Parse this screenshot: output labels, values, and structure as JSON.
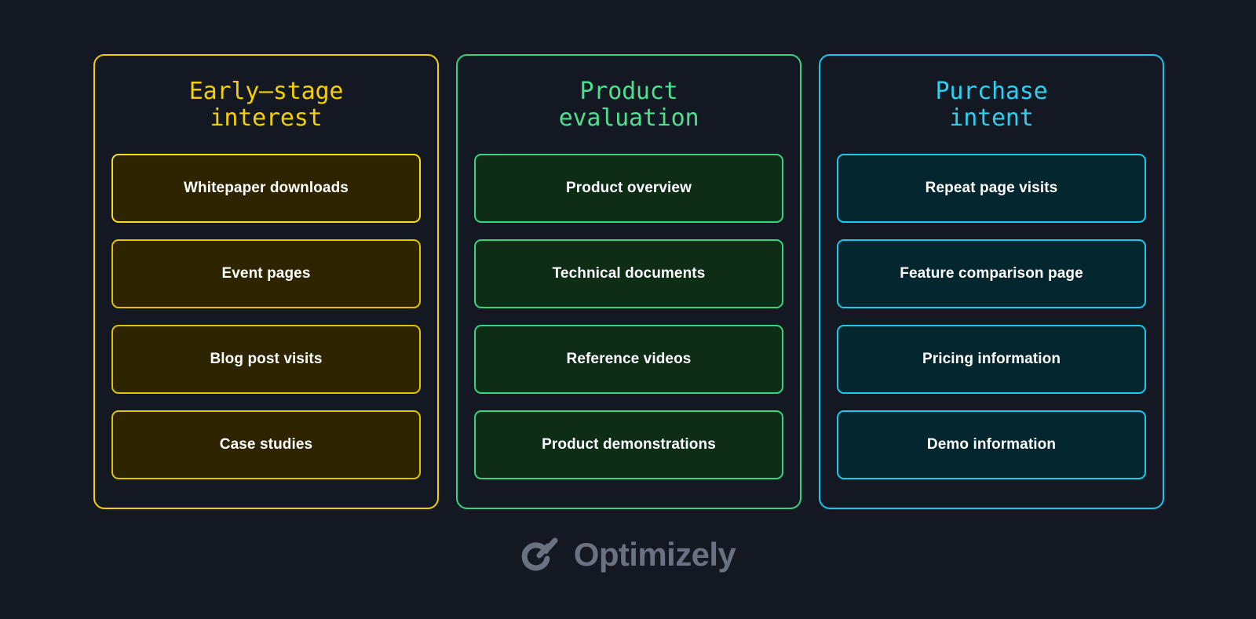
{
  "columns": [
    {
      "id": "early-stage-interest",
      "title": "Early—stage\ninterest",
      "accent": "#F5D000",
      "card_fill": "#2E2400",
      "cards": [
        {
          "label": "Whitepaper downloads"
        },
        {
          "label": "Event pages"
        },
        {
          "label": "Blog post visits"
        },
        {
          "label": "Case studies"
        }
      ]
    },
    {
      "id": "product-evaluation",
      "title": "Product\nevaluation",
      "accent": "#33D67F",
      "card_fill": "#0D2D17",
      "cards": [
        {
          "label": "Product overview"
        },
        {
          "label": "Technical documents"
        },
        {
          "label": "Reference videos"
        },
        {
          "label": "Product demonstrations"
        }
      ]
    },
    {
      "id": "purchase-intent",
      "title": "Purchase\nintent",
      "accent": "#16C8F0",
      "card_fill": "#04272F",
      "cards": [
        {
          "label": "Repeat page visits"
        },
        {
          "label": "Feature comparison page"
        },
        {
          "label": "Pricing information"
        },
        {
          "label": "Demo information"
        }
      ]
    }
  ],
  "footer": {
    "logo_icon": "optimizely-logo-icon",
    "brand": "Optimizely",
    "brand_color": "#6A7180"
  },
  "background_color": "#141823",
  "card_text_color": "#FFFFFF"
}
